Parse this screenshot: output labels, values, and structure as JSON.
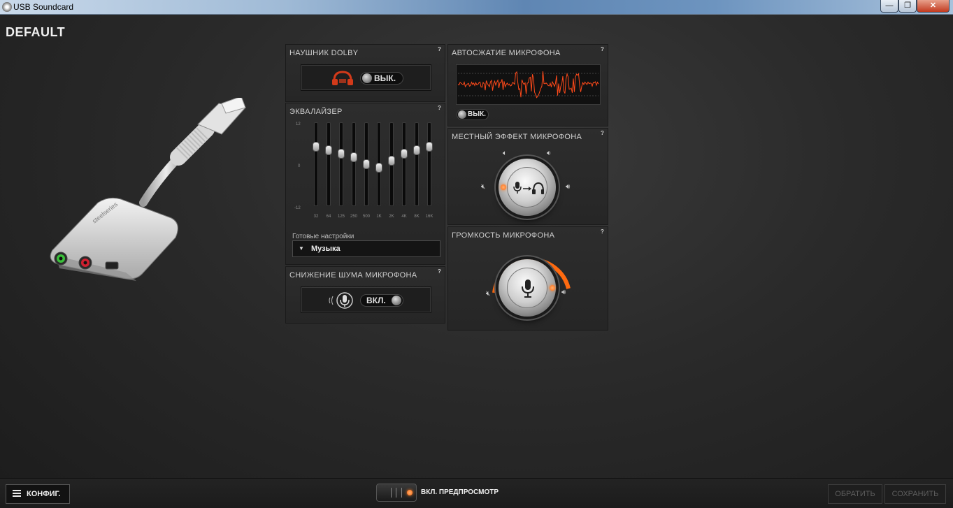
{
  "window": {
    "title": "USB Soundcard",
    "minimize_label": "—",
    "maximize_label": "❐",
    "close_label": "✕"
  },
  "profile": {
    "name": "DEFAULT"
  },
  "device": {
    "brand_text": "steelseries"
  },
  "dolby": {
    "title": "НАУШНИК DOLBY",
    "help": "?",
    "toggle_label": "ВЫК.",
    "state": "off",
    "icon": "headphones-icon"
  },
  "equalizer": {
    "title": "ЭКВАЛАЙЗЕР",
    "help": "?",
    "scale_top": "12",
    "scale_mid": "0",
    "scale_bottom": "-12",
    "bands": [
      {
        "label": "32",
        "gain": 5
      },
      {
        "label": "64",
        "gain": 4
      },
      {
        "label": "125",
        "gain": 3
      },
      {
        "label": "250",
        "gain": 2
      },
      {
        "label": "500",
        "gain": 0
      },
      {
        "label": "1K",
        "gain": -1
      },
      {
        "label": "2K",
        "gain": 1
      },
      {
        "label": "4K",
        "gain": 3
      },
      {
        "label": "8K",
        "gain": 4
      },
      {
        "label": "16K",
        "gain": 5
      }
    ],
    "preset_label": "Готовые настройки",
    "preset_value": "Музыка"
  },
  "noise_reduction": {
    "title": "СНИЖЕНИЕ ШУМА МИКРОФОНА",
    "help": "?",
    "toggle_label": "ВКЛ.",
    "state": "on",
    "icon": "microphone-icon"
  },
  "autogain": {
    "title": "АВТОСЖАТИЕ МИКРОФОНА",
    "help": "?",
    "toggle_label": "ВЫК.",
    "state": "off",
    "waveform_color": "#ff4a1a"
  },
  "sidetone": {
    "title": "МЕСТНЫЙ ЭФФЕКТ МИКРОФОНА",
    "help": "?",
    "level": 0,
    "icon": "mic-to-headphones-icon"
  },
  "mic_volume": {
    "title": "ГРОМКОСТЬ МИКРОФОНА",
    "help": "?",
    "level": 1.0,
    "accent": "#ff6a10"
  },
  "bottom": {
    "config_label": "КОНФИГ.",
    "preview_label": "ВКЛ. ПРЕДПРОСМОТР",
    "revert_label": "ОБРАТИТЬ",
    "save_label": "СОХРАНИТЬ"
  },
  "colors": {
    "accent": "#ff6a10"
  }
}
